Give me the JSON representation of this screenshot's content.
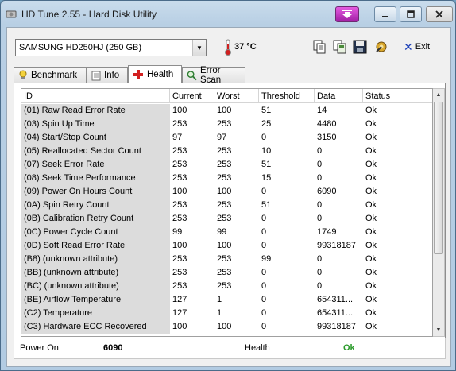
{
  "window": {
    "title": "HD Tune 2.55 - Hard Disk Utility"
  },
  "toolbar": {
    "drive": "SAMSUNG HD250HJ (250 GB)",
    "temperature": "37 °C",
    "exit_label": "Exit",
    "icons": [
      "copy-icon",
      "copy-screen-icon",
      "save-icon",
      "options-icon",
      "exit-icon"
    ]
  },
  "tabs": [
    {
      "label": "Benchmark",
      "icon": "benchmark-icon",
      "active": false
    },
    {
      "label": "Info",
      "icon": "info-icon",
      "active": false
    },
    {
      "label": "Health",
      "icon": "health-cross-icon",
      "active": true
    },
    {
      "label": "Error Scan",
      "icon": "magnifier-icon",
      "active": false
    }
  ],
  "table": {
    "columns": [
      "ID",
      "Current",
      "Worst",
      "Threshold",
      "Data",
      "Status"
    ],
    "rows": [
      [
        "(01) Raw Read Error Rate",
        "100",
        "100",
        "51",
        "14",
        "Ok"
      ],
      [
        "(03) Spin Up Time",
        "253",
        "253",
        "25",
        "4480",
        "Ok"
      ],
      [
        "(04) Start/Stop Count",
        "97",
        "97",
        "0",
        "3150",
        "Ok"
      ],
      [
        "(05) Reallocated Sector Count",
        "253",
        "253",
        "10",
        "0",
        "Ok"
      ],
      [
        "(07) Seek Error Rate",
        "253",
        "253",
        "51",
        "0",
        "Ok"
      ],
      [
        "(08) Seek Time Performance",
        "253",
        "253",
        "15",
        "0",
        "Ok"
      ],
      [
        "(09) Power On Hours Count",
        "100",
        "100",
        "0",
        "6090",
        "Ok"
      ],
      [
        "(0A) Spin Retry Count",
        "253",
        "253",
        "51",
        "0",
        "Ok"
      ],
      [
        "(0B) Calibration Retry Count",
        "253",
        "253",
        "0",
        "0",
        "Ok"
      ],
      [
        "(0C) Power Cycle Count",
        "99",
        "99",
        "0",
        "1749",
        "Ok"
      ],
      [
        "(0D) Soft Read Error Rate",
        "100",
        "100",
        "0",
        "99318187",
        "Ok"
      ],
      [
        "(B8) (unknown attribute)",
        "253",
        "253",
        "99",
        "0",
        "Ok"
      ],
      [
        "(BB) (unknown attribute)",
        "253",
        "253",
        "0",
        "0",
        "Ok"
      ],
      [
        "(BC) (unknown attribute)",
        "253",
        "253",
        "0",
        "0",
        "Ok"
      ],
      [
        "(BE) Airflow Temperature",
        "127",
        "1",
        "0",
        "654311...",
        "Ok"
      ],
      [
        "(C2) Temperature",
        "127",
        "1",
        "0",
        "654311...",
        "Ok"
      ],
      [
        "(C3) Hardware ECC Recovered",
        "100",
        "100",
        "0",
        "99318187",
        "Ok"
      ]
    ]
  },
  "status": {
    "power_on_label": "Power On",
    "power_on_value": "6090",
    "health_label": "Health",
    "health_value": "Ok",
    "health_color": "#2a9a2a"
  }
}
